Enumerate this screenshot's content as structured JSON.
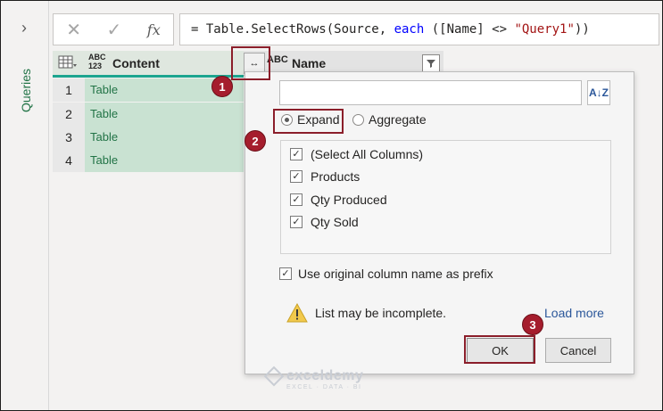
{
  "queries_pane": {
    "expand_glyph": "›",
    "label": "Queries"
  },
  "formula_bar": {
    "cancel_glyph": "✕",
    "commit_glyph": "✓",
    "fx_label": "fx",
    "formula_parts": [
      "= Table.SelectRows(Source, ",
      "each",
      " ([Name] <> ",
      "\"Query1\"",
      "))"
    ]
  },
  "grid": {
    "type_label_1": "ABC\n123",
    "col_content": "Content",
    "expand_glyph": "↔",
    "type_label_2": "ABC",
    "col_name": "Name",
    "rows": [
      {
        "num": "1",
        "value": "Table"
      },
      {
        "num": "2",
        "value": "Table"
      },
      {
        "num": "3",
        "value": "Table"
      },
      {
        "num": "4",
        "value": "Table"
      }
    ]
  },
  "dialog": {
    "search_placeholder": "",
    "sort_glyph": "A↓Z",
    "mode_expand": "Expand",
    "mode_aggregate": "Aggregate",
    "selected_mode": "Expand",
    "columns": [
      {
        "label": "(Select All Columns)",
        "checked": true
      },
      {
        "label": "Products",
        "checked": true
      },
      {
        "label": "Qty Produced",
        "checked": true
      },
      {
        "label": "Qty Sold",
        "checked": true
      }
    ],
    "prefix_label": "Use original column name as prefix",
    "prefix_checked": true,
    "warning": "List may be incomplete.",
    "load_more": "Load more",
    "ok": "OK",
    "cancel": "Cancel"
  },
  "annotations": {
    "step1": "1",
    "step2": "2",
    "step3": "3",
    "accent_color": "#a51d2d"
  },
  "watermark": {
    "name": "exceldemy",
    "tagline": "EXCEL · DATA · BI"
  },
  "colors": {
    "selected_column": "#c9e2d2",
    "header_accent": "#1ca58f",
    "cell_text": "#217346",
    "link": "#2b579a"
  }
}
